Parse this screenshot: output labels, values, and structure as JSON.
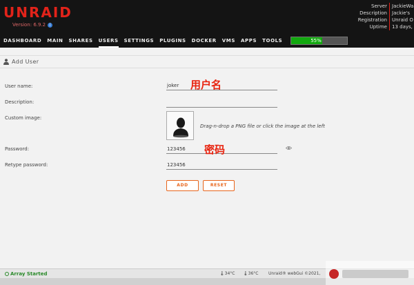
{
  "header": {
    "logo": "UNRAID",
    "version": "Version: 6.9.2",
    "server_info": [
      {
        "key": "Server",
        "value": "JackieWa"
      },
      {
        "key": "Description",
        "value": "Jackie's"
      },
      {
        "key": "Registration",
        "value": "Unraid O"
      },
      {
        "key": "Uptime",
        "value": "13 days,"
      }
    ]
  },
  "nav": {
    "items": [
      "DASHBOARD",
      "MAIN",
      "SHARES",
      "USERS",
      "SETTINGS",
      "PLUGINS",
      "DOCKER",
      "VMS",
      "APPS",
      "TOOLS"
    ],
    "active": "USERS",
    "cpu_load_text": "55%",
    "cpu_load": 0.55
  },
  "page": {
    "title": "Add User"
  },
  "form": {
    "username_label": "User name:",
    "username_value": "joker",
    "username_annotation": "用户名",
    "description_label": "Description:",
    "description_value": "",
    "image_label": "Custom image:",
    "image_hint": "Drag-n-drop a PNG file or click the image at the left",
    "password_label": "Password:",
    "password_value": "123456",
    "password_annotation": "密码",
    "retype_label": "Retype password:",
    "retype_value": "123456",
    "add_button": "ADD",
    "reset_button": "RESET"
  },
  "footer": {
    "array_status": "Array Started",
    "temp1": "34°C",
    "temp2": "36°C",
    "copyright": "Unraid® webGui ©2021,"
  },
  "colors": {
    "brand": "#e2231a",
    "accent": "#e8641a",
    "status_ok": "#2a8a2a",
    "cpu_bar": "#12a80f"
  },
  "icons": {
    "info": "info-circle-icon",
    "user": "user-icon",
    "avatar": "avatar-silhouette-icon",
    "eye": "eye-icon",
    "array": "status-dot-icon",
    "thermometer": "thermometer-icon"
  }
}
